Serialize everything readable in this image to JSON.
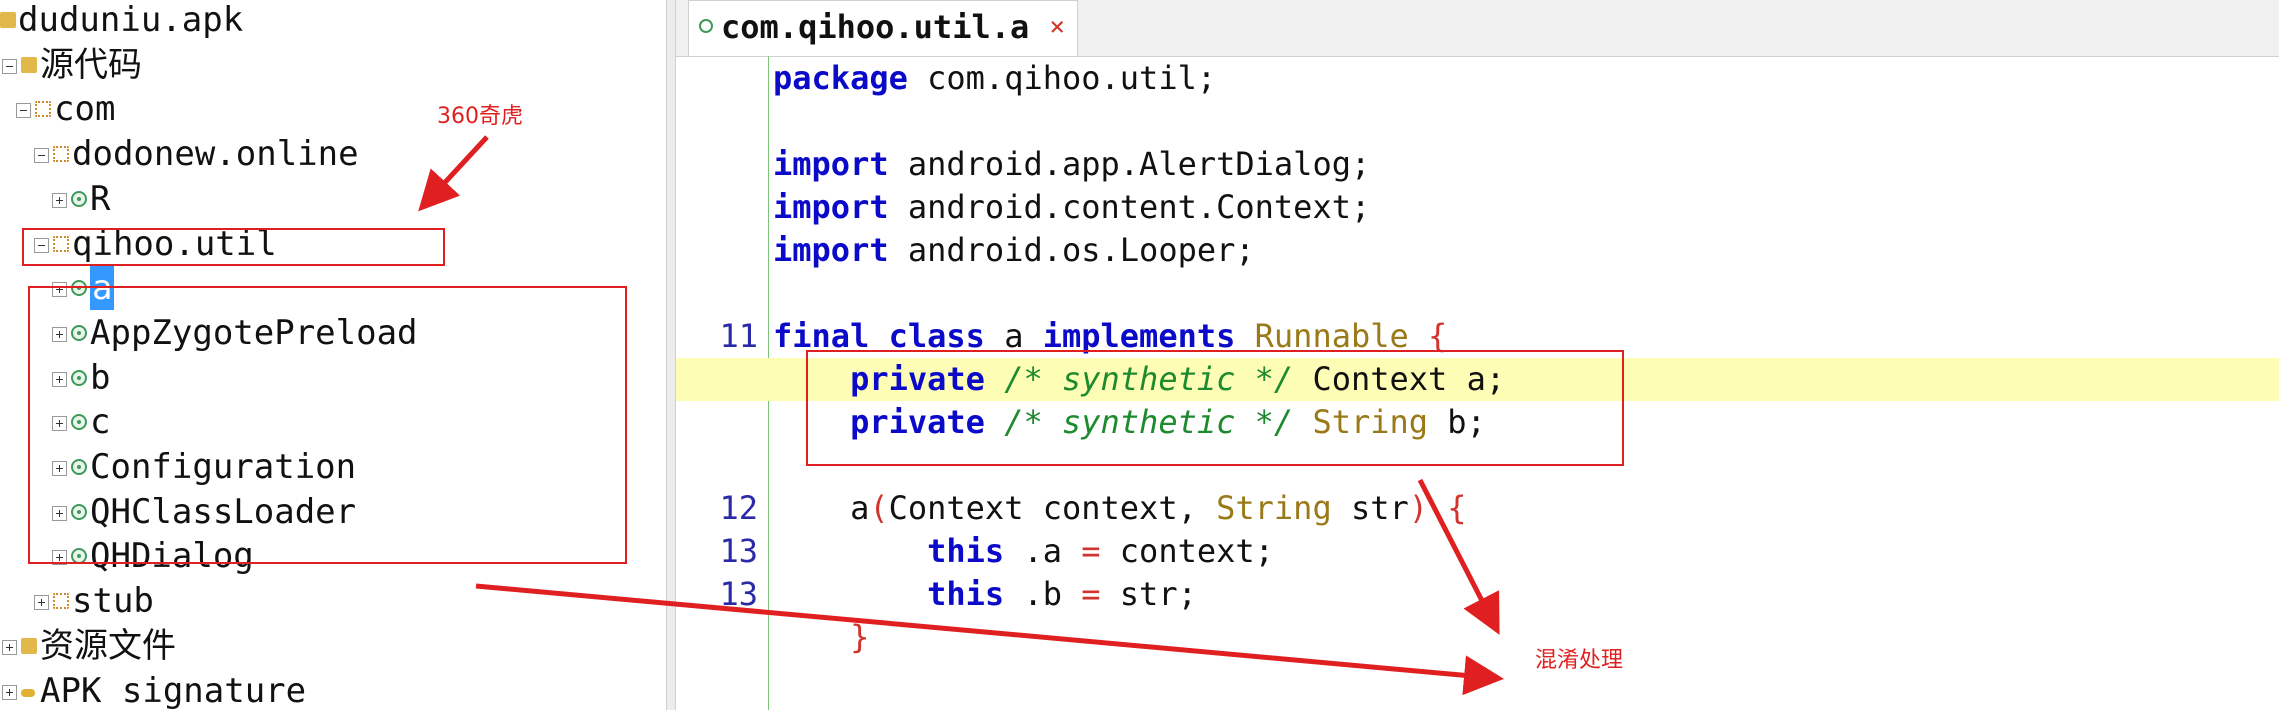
{
  "tree": {
    "items": [
      {
        "label": "duduniu.apk",
        "level": 0
      },
      {
        "label": "源代码",
        "level": 1
      },
      {
        "label": "com",
        "level": 2
      },
      {
        "label": "dodonew.online",
        "level": 3
      },
      {
        "label": "R",
        "level": 4
      },
      {
        "label": "qihoo.util",
        "level": 3
      },
      {
        "label": "a",
        "level": 4,
        "selected": true
      },
      {
        "label": "AppZygotePreload",
        "level": 4
      },
      {
        "label": "b",
        "level": 4
      },
      {
        "label": "c",
        "level": 4
      },
      {
        "label": "Configuration",
        "level": 4
      },
      {
        "label": "QHClassLoader",
        "level": 4
      },
      {
        "label": "QHDialog",
        "level": 4
      },
      {
        "label": "stub",
        "level": 3
      },
      {
        "label": "资源文件",
        "level": 1
      },
      {
        "label": "APK signature",
        "level": 1
      }
    ]
  },
  "editor": {
    "tab_title": "com.qihoo.util.a",
    "tab_close": "×"
  },
  "code": {
    "lines": [
      {
        "num": "",
        "parts": [
          [
            "kw",
            "package"
          ],
          [
            "",
            "com.qihoo.util;"
          ]
        ]
      },
      {
        "num": "",
        "parts": []
      },
      {
        "num": "",
        "parts": [
          [
            "kw",
            "import"
          ],
          [
            "",
            "android.app.AlertDialog;"
          ]
        ]
      },
      {
        "num": "",
        "parts": [
          [
            "kw",
            "import"
          ],
          [
            "",
            "android.content.Context;"
          ]
        ]
      },
      {
        "num": "",
        "parts": [
          [
            "kw",
            "import"
          ],
          [
            "",
            "android.os.Looper;"
          ]
        ]
      },
      {
        "num": "",
        "parts": []
      },
      {
        "num": "11",
        "parts": [
          [
            "kw",
            "final class"
          ],
          [
            "",
            " a "
          ],
          [
            "kw",
            "implements"
          ],
          [
            "",
            " "
          ],
          [
            "ty",
            "Runnable"
          ],
          [
            "op",
            " {"
          ]
        ]
      },
      {
        "num": "",
        "highlight": true,
        "parts": [
          [
            "",
            "    "
          ],
          [
            "kw",
            "private"
          ],
          [
            "",
            " "
          ],
          [
            "cm",
            "/* synthetic */"
          ],
          [
            "",
            " Context a;"
          ]
        ]
      },
      {
        "num": "",
        "parts": [
          [
            "",
            "    "
          ],
          [
            "kw",
            "private"
          ],
          [
            "",
            " "
          ],
          [
            "cm",
            "/* synthetic */"
          ],
          [
            "",
            " "
          ],
          [
            "ty",
            "String"
          ],
          [
            "",
            " b;"
          ]
        ]
      },
      {
        "num": "",
        "parts": []
      },
      {
        "num": "12",
        "parts": [
          [
            "",
            "    a"
          ],
          [
            "op",
            "("
          ],
          [
            "",
            "Context context, "
          ],
          [
            "ty",
            "String"
          ],
          [
            "",
            " str"
          ],
          [
            "op",
            ") {"
          ]
        ]
      },
      {
        "num": "13",
        "parts": [
          [
            "",
            "        "
          ],
          [
            "kw",
            "this"
          ],
          [
            "",
            ".a "
          ],
          [
            "op",
            "="
          ],
          [
            "",
            " context;"
          ]
        ]
      },
      {
        "num": "13",
        "parts": [
          [
            "",
            "        "
          ],
          [
            "kw",
            "this"
          ],
          [
            "",
            ".b "
          ],
          [
            "op",
            "="
          ],
          [
            "",
            " str;"
          ]
        ]
      },
      {
        "num": "",
        "parts": [
          [
            "op",
            "    }"
          ]
        ]
      }
    ]
  },
  "annotations": {
    "qihoo_note": "360奇虎",
    "obfuscation_note": "混淆处理"
  },
  "colors": {
    "annotation": "#e02020",
    "keyword": "#0a0ac8",
    "type": "#9a7a18",
    "comment": "#1e8a2e",
    "highlight": "#fdfdb6"
  }
}
